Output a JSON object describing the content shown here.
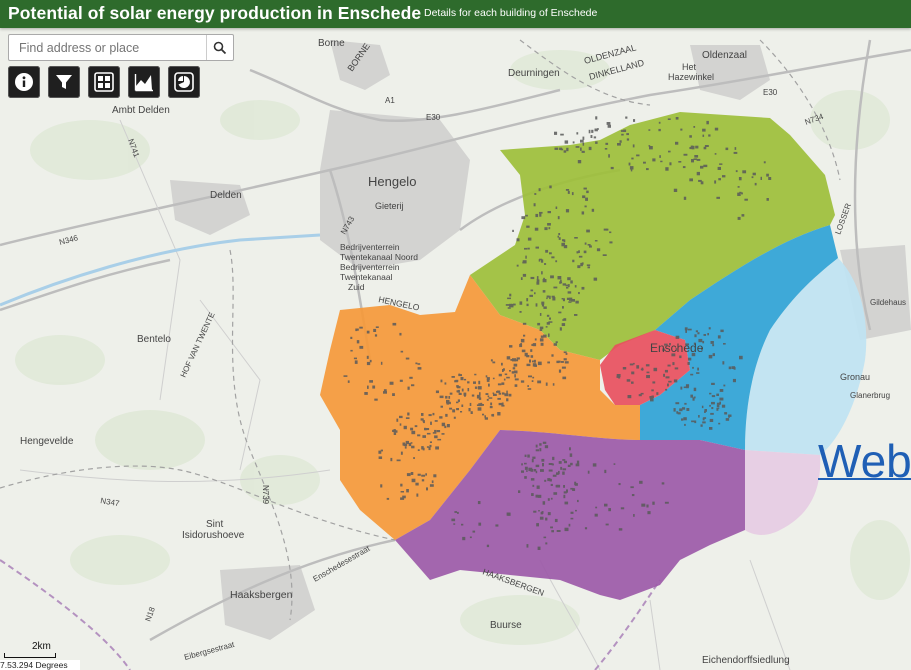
{
  "header": {
    "title": "Potential of solar energy production in Enschede",
    "subtitle": "Details for each building of Enschede"
  },
  "search": {
    "placeholder": "Find address or place"
  },
  "toolbar": {
    "tools": [
      {
        "icon": "info-icon"
      },
      {
        "icon": "filter-icon"
      },
      {
        "icon": "grid-icon"
      },
      {
        "icon": "area-chart-icon"
      },
      {
        "icon": "pie-chart-icon"
      }
    ]
  },
  "scale": {
    "label": "2km"
  },
  "coords": "7.53.294 Degrees",
  "overlay_text": "Web",
  "zone_colors": {
    "north": "#9dbf3a",
    "east": "#2fa3d6",
    "center": "#e8505e",
    "west": "#f5993a",
    "south": "#9c5aa8",
    "outer_east": "#bfe3f2",
    "outer_south": "#e6cce3"
  },
  "map_labels": {
    "borne": "Borne",
    "borne_road": "BORNE",
    "deurningen": "Deurningen",
    "oldenzaal_road": "OLDENZAAL",
    "dinkelland": "DINKELLAND",
    "oldenzaal": "Oldenzaal",
    "het": "Het",
    "hazewinkel": "Hazewinkel",
    "a1": "A1",
    "e30a": "E30",
    "e30b": "E30",
    "n734": "N734",
    "ambt_delden": "Ambt Delden",
    "n741": "N741",
    "hengelo": "Hengelo",
    "gietenj": "Gieterij",
    "delden": "Delden",
    "n346": "N346",
    "n743": "N743",
    "bedr1": "Bedrijventerrein",
    "bedr2": "Twentekanaal Noord",
    "bedr3": "Bedrijventerrein",
    "bedr4": "Twentekanaal",
    "bedr5": "Zuid",
    "hengelo_road": "HENGELO",
    "losser": "LOSSER",
    "hof_van_twente": "HOF VAN TWENTE",
    "bentelo": "Bentelo",
    "enschede": "Enschede",
    "hengevelde": "Hengevelde",
    "n739": "N739",
    "n347": "N347",
    "sint": "Sint",
    "isidorushoeve": "Isidorushoeve",
    "enschedestraat": "Enschedesestraat",
    "haaksbergen_road": "HAAKSBERGEN",
    "haaksbergen": "Haaksbergen",
    "n18": "N18",
    "eibergsestraat": "Eibergsestraat",
    "buurse": "Buurse",
    "eichendorffsiedlung": "Eichendorffsiedlung",
    "gronau": "Gronau",
    "gildehaus": "Gildehaus",
    "glanerbrug": "Glanerbrug"
  }
}
